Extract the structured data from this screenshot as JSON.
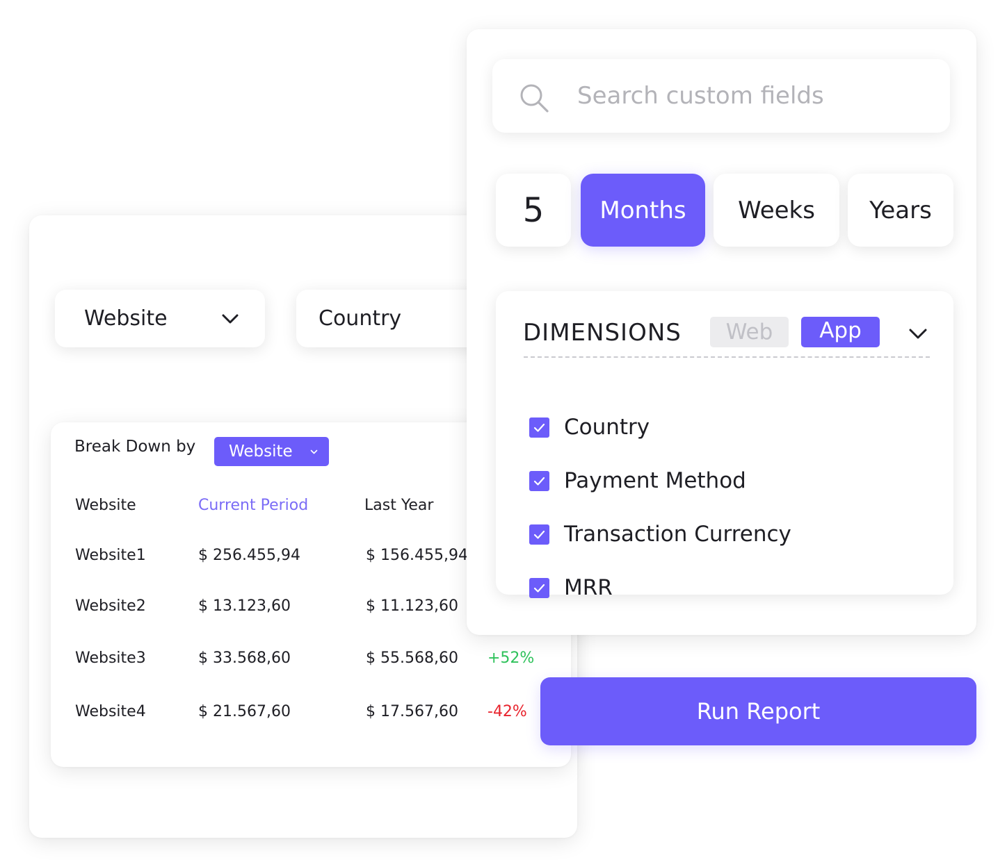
{
  "report": {
    "dropdowns": [
      {
        "label": "Website"
      },
      {
        "label": "Country"
      }
    ],
    "breakdown": {
      "label": "Break Down by",
      "select_value": "Website",
      "columns": [
        "Website",
        "Current Period",
        "Last Year"
      ],
      "rows": [
        {
          "site": "Website1",
          "current": "$ 256.455,94",
          "last_year": "$ 156.455,94",
          "change": ""
        },
        {
          "site": "Website2",
          "current": "$ 13.123,60",
          "last_year": "$ 11.123,60",
          "change": ""
        },
        {
          "site": "Website3",
          "current": "$ 33.568,60",
          "last_year": "$ 55.568,60",
          "change": "+52%"
        },
        {
          "site": "Website4",
          "current": "$ 21.567,60",
          "last_year": "$ 17.567,60",
          "change": "-42%"
        }
      ]
    }
  },
  "settings": {
    "search": {
      "placeholder": "Search custom fields",
      "value": "",
      "icon": "search-icon"
    },
    "period": {
      "count": "5",
      "units": [
        "Months",
        "Weeks",
        "Years"
      ],
      "selected": "Months"
    },
    "dimensions": {
      "title": "DIMENSIONS",
      "tags": [
        "Web",
        "App"
      ],
      "active_tag": "App",
      "items": [
        {
          "label": "Country",
          "checked": true
        },
        {
          "label": "Payment Method",
          "checked": true
        },
        {
          "label": "Transaction Currency",
          "checked": true
        },
        {
          "label": "MRR",
          "checked": true
        }
      ]
    },
    "run_button": "Run Report"
  },
  "colors": {
    "accent": "#6c5cfa",
    "positive": "#2fc25b",
    "negative": "#e8232d",
    "accent_text": "#7b6cf6"
  }
}
